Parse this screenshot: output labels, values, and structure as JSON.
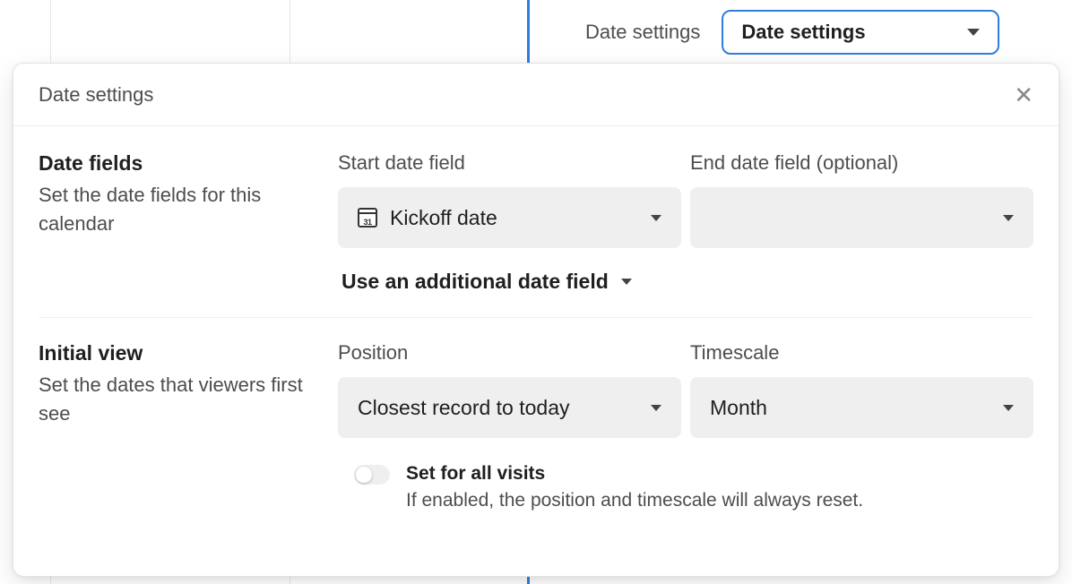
{
  "toprow": {
    "label": "Date settings",
    "dropdown_value": "Date settings"
  },
  "panel": {
    "title": "Date settings"
  },
  "date_fields": {
    "heading": "Date fields",
    "desc": "Set the date fields for this calendar",
    "start_label": "Start date field",
    "start_value": "Kickoff date",
    "end_label": "End date field (optional)",
    "end_value": "",
    "additional_link": "Use an additional date field"
  },
  "initial_view": {
    "heading": "Initial view",
    "desc": "Set the dates that viewers first see",
    "position_label": "Position",
    "position_value": "Closest record to today",
    "timescale_label": "Timescale",
    "timescale_value": "Month",
    "toggle_label": "Set for all visits",
    "toggle_desc": "If enabled, the position and timescale will always reset.",
    "toggle_on": false
  }
}
